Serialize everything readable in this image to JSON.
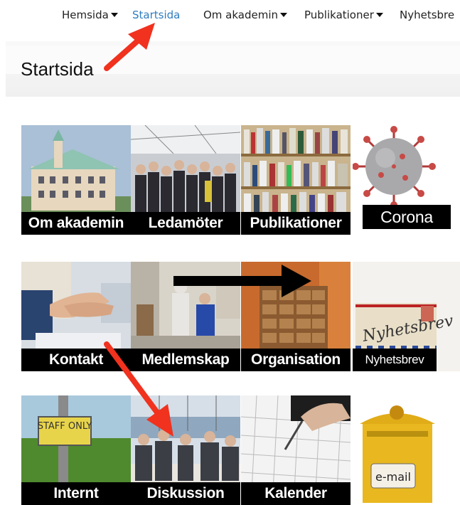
{
  "nav": {
    "items": [
      {
        "label": "Hemsida",
        "dropdown": true
      },
      {
        "label": "Startsida",
        "active": true
      },
      {
        "label": "Om akademin",
        "dropdown": true
      },
      {
        "label": "Publikationer",
        "dropdown": true
      },
      {
        "label": "Nyhetsbre"
      }
    ]
  },
  "page": {
    "title": "Startsida"
  },
  "tiles": [
    {
      "label": "Om akademin"
    },
    {
      "label": "Ledamöter"
    },
    {
      "label": "Publikationer"
    },
    {
      "label": "Corona"
    },
    {
      "label": "Kontakt"
    },
    {
      "label": "Medlemskap"
    },
    {
      "label": "Organisation"
    },
    {
      "label": "Nyhetsbrev",
      "image_text": "Nyhetsbrev"
    },
    {
      "label": "Internt",
      "image_text": "STAFF ONLY"
    },
    {
      "label": "Diskussion"
    },
    {
      "label": "Kalender"
    },
    {
      "label": "",
      "image_text": "e-mail"
    }
  ],
  "colors": {
    "active_link": "#2e7dbf",
    "arrow_red": "#f0321e",
    "arrow_black": "#000000"
  }
}
